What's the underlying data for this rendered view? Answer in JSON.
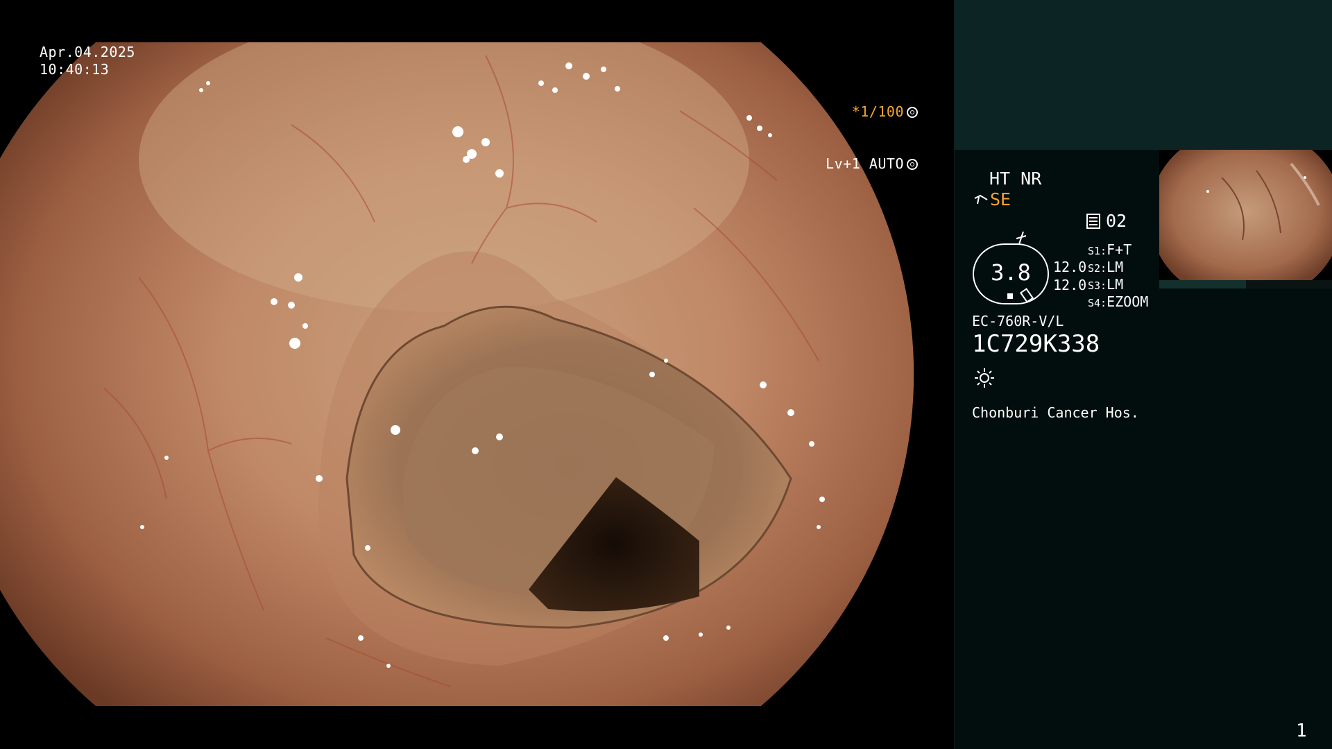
{
  "overlay": {
    "date": "Apr.04.2025",
    "time": "10:40:13",
    "shutter": "*1/100",
    "level": "Lv+1 AUTO"
  },
  "panel": {
    "ht_nr": "HT NR",
    "mode": "SE",
    "memory": "02",
    "zoom": "3.8",
    "ratio_top": "12.0",
    "ratio_bottom": "12.0",
    "switches": [
      {
        "key": "S1:",
        "value": "F+T"
      },
      {
        "key": "S2:",
        "value": "LM"
      },
      {
        "key": "S3:",
        "value": "LM"
      },
      {
        "key": "S4:",
        "value": "EZOOM"
      }
    ],
    "scope_model": "EC-760R-V/L",
    "scope_serial": "1C729K338",
    "hospital": "Chonburi Cancer Hos.",
    "page_number": "1"
  },
  "colors": {
    "accent_orange": "#f6a431",
    "panel_top": "#0c2524",
    "panel_bg": "#020e0d",
    "tissue": "#c48a64"
  },
  "icons": [
    "shutter-icon",
    "auto-iris-icon",
    "structure-enhance-icon",
    "color-enhance-icon",
    "memory-icon",
    "light-source-icon"
  ]
}
